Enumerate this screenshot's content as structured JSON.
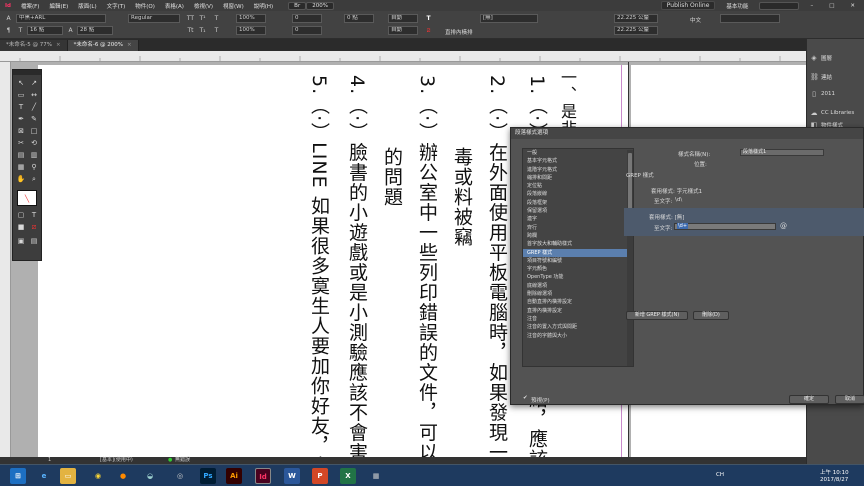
{
  "menubar": {
    "items": [
      "檔案(F)",
      "編輯(E)",
      "版面(L)",
      "文字(T)",
      "物件(O)",
      "表格(A)",
      "檢視(V)",
      "視窗(W)",
      "說明(H)"
    ],
    "zoom": "200%",
    "publish": "Publish Online",
    "workspace": "基本功能"
  },
  "control": {
    "font_family": "中黑+ARL",
    "font_style": "Regular",
    "font_size": "16 點",
    "leading": "28 點",
    "scale_v": "100%",
    "scale_h": "100%",
    "tracking": "0",
    "kerning": "0",
    "baseline": "0 點",
    "aki": "自動",
    "grid": "自動",
    "ruby_value": "[無]",
    "char_style": "[無]",
    "lang": "直排內橫排",
    "width1": "22.225 公釐",
    "width2": "22.225 公釐",
    "align": "中文"
  },
  "tabs": [
    {
      "label": "*未命名-5 @ 77%",
      "active": false
    },
    {
      "label": "*未命名-6 @ 200%",
      "active": true
    }
  ],
  "document": {
    "columns": [
      {
        "text": "一、是非",
        "class": "c0"
      },
      {
        "text": "1.（·）手機LINE傳來有趣的圖片連結，應該",
        "class": "c1"
      },
      {
        "text": "2.（·）在外面使用平板電腦時，如果發現一",
        "class": "c2"
      },
      {
        "text": "毒或料被竊",
        "class": "c2b"
      },
      {
        "text": "3.（·）辦公室中一些列印錯誤的文件，可以",
        "class": "c3"
      },
      {
        "text": "的問題",
        "class": "c3b"
      },
      {
        "text": "4.（·）臉書的小遊戲或是小測驗應該不會害",
        "class": "c4"
      },
      {
        "text": "5.（·）LINE 如果很多寞生人要加你好友，表",
        "class": "c5"
      }
    ]
  },
  "dock": {
    "items": [
      "圖層",
      "連結",
      "2011",
      "CC Libraries",
      "物件樣式",
      "顏色",
      "色票",
      "描邊",
      "漸層",
      "效果"
    ]
  },
  "dialog": {
    "title": "段落樣式選項",
    "list": [
      "一般",
      "基本字元格式",
      "進階字元格式",
      "縮排和間距",
      "定位點",
      "段落嵌線",
      "段落框架",
      "保留選項",
      "連字",
      "齊行",
      "跨欄",
      "首字放大和輔助樣式",
      "GREP 樣式",
      "項目符號和編號",
      "字元顏色",
      "OpenType 功能",
      "底線選項",
      "刪除線選項",
      "自動直排內橫排設定",
      "直排內橫排設定",
      "注音",
      "注音的置入方式與間距",
      "注音的字體與大小"
    ],
    "selected_index": 12,
    "style_name_label": "樣式名稱(N):",
    "style_name_value": "段落樣式1",
    "position_label": "位置:",
    "section": "GREP 樣式",
    "apply1_label": "套用樣式: 字元樣式1",
    "to_text1_label": "至文字:",
    "to_text1_value": "\\d\\",
    "apply2_label": "套用樣式: [無]",
    "to_text2_label": "至文字:",
    "to_text2_value": "\\d+",
    "new_grep_button": "新增 GREP 樣式(N)",
    "delete_button": "刪除(D)",
    "preview_label": "預視(P)",
    "ok_button": "確定",
    "cancel_button": "取消"
  },
  "statusbar": {
    "page": "1",
    "style": "[基本](使用中)",
    "error": "無錯誤"
  },
  "taskbar": {
    "lang": "CH",
    "time": "上午 10:10",
    "date": "2017/8/27",
    "apps": [
      "start",
      "ie",
      "explorer",
      "chrome",
      "ps",
      "ai",
      "id",
      "word",
      "ppt",
      "excel",
      "other"
    ]
  },
  "colors": {
    "accent_blue": "#5b7fae",
    "indesign": "#ff3366",
    "photoshop": "#31a8ff",
    "illustrator": "#ff9a00"
  }
}
